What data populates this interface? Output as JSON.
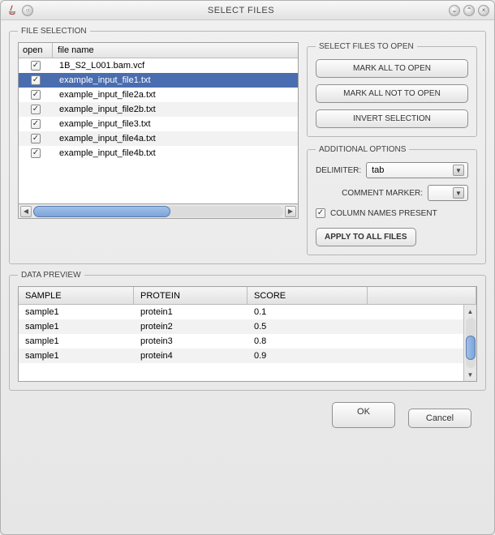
{
  "window": {
    "title": "SELECT FILES"
  },
  "file_selection": {
    "legend": "FILE SELECTION",
    "header_open": "open",
    "header_name": "file name",
    "rows": [
      {
        "checked": true,
        "selected": false,
        "name": "1B_S2_L001.bam.vcf"
      },
      {
        "checked": true,
        "selected": true,
        "name": "example_input_file1.txt"
      },
      {
        "checked": true,
        "selected": false,
        "name": "example_input_file2a.txt"
      },
      {
        "checked": true,
        "selected": false,
        "name": "example_input_file2b.txt"
      },
      {
        "checked": true,
        "selected": false,
        "name": "example_input_file3.txt"
      },
      {
        "checked": true,
        "selected": false,
        "name": "example_input_file4a.txt"
      },
      {
        "checked": true,
        "selected": false,
        "name": "example_input_file4b.txt"
      }
    ]
  },
  "select_panel": {
    "legend": "SELECT FILES TO OPEN",
    "mark_all": "MARK ALL TO OPEN",
    "mark_none": "MARK ALL NOT TO OPEN",
    "invert": "INVERT SELECTION"
  },
  "options": {
    "legend": "ADDITIONAL OPTIONS",
    "delimiter_label": "DELIMITER:",
    "delimiter_value": "tab",
    "comment_label": "COMMENT MARKER:",
    "comment_value": "",
    "col_names_checked": true,
    "col_names_label": "COLUMN NAMES PRESENT",
    "apply_label": "APPLY TO ALL FILES"
  },
  "preview": {
    "legend": "DATA PREVIEW",
    "columns": [
      "SAMPLE",
      "PROTEIN",
      "SCORE"
    ],
    "rows": [
      [
        "sample1",
        "protein1",
        "0.1"
      ],
      [
        "sample1",
        "protein2",
        "0.5"
      ],
      [
        "sample1",
        "protein3",
        "0.8"
      ],
      [
        "sample1",
        "protein4",
        "0.9"
      ]
    ]
  },
  "dialog": {
    "ok": "OK",
    "cancel": "Cancel"
  }
}
